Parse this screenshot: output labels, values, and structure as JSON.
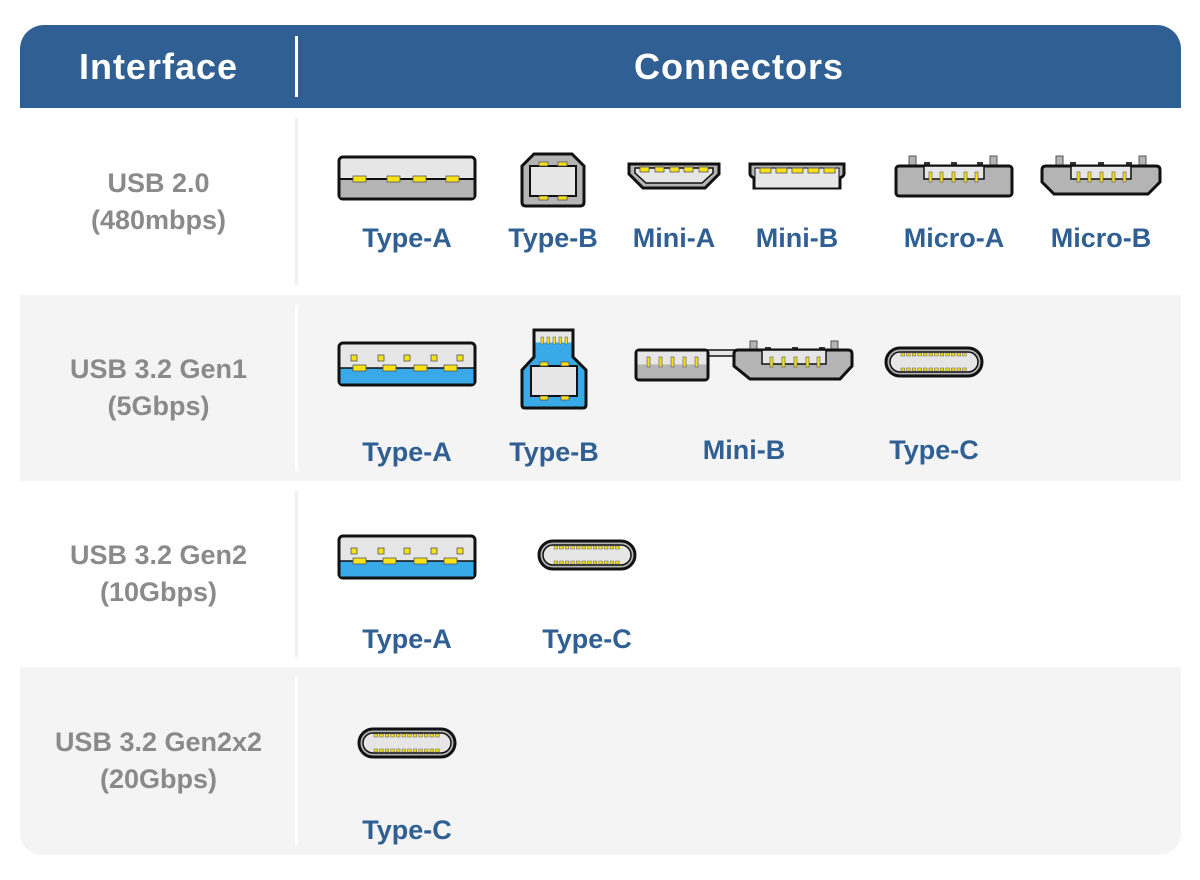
{
  "header": {
    "interface": "Interface",
    "connectors": "Connectors"
  },
  "colors": {
    "header_bg": "#2f5f93",
    "label_gray": "#8a8a8a",
    "connector_name_blue": "#2f5f93",
    "usb3_blue": "#39a9e8",
    "pin_yellow": "#f7e217",
    "shell_gray": "#b4b4b4",
    "inner_light": "#e6e6e6"
  },
  "rows": [
    {
      "interface": "USB 2.0",
      "speed": "(480mbps)",
      "connectors": [
        {
          "name": "Type-A",
          "icon": "usb2-type-a-icon"
        },
        {
          "name": "Type-B",
          "icon": "usb2-type-b-icon"
        },
        {
          "name": "Mini-A",
          "icon": "mini-a-icon"
        },
        {
          "name": "Mini-B",
          "icon": "mini-b-icon"
        },
        {
          "name": "Micro-A",
          "icon": "micro-a-icon"
        },
        {
          "name": "Micro-B",
          "icon": "micro-b-icon"
        }
      ]
    },
    {
      "interface": "USB 3.2 Gen1",
      "speed": "(5Gbps)",
      "connectors": [
        {
          "name": "Type-A",
          "icon": "usb3-type-a-icon"
        },
        {
          "name": "Type-B",
          "icon": "usb3-type-b-icon"
        },
        {
          "name": "Mini-B",
          "icon": "usb3-micro-b-icon"
        },
        {
          "name": "Type-C",
          "icon": "type-c-icon"
        }
      ]
    },
    {
      "interface": "USB 3.2 Gen2",
      "speed": "(10Gbps)",
      "connectors": [
        {
          "name": "Type-A",
          "icon": "usb3-type-a-icon"
        },
        {
          "name": "Type-C",
          "icon": "type-c-icon"
        }
      ]
    },
    {
      "interface": "USB 3.2 Gen2x2",
      "speed": "(20Gbps)",
      "connectors": [
        {
          "name": "Type-C",
          "icon": "type-c-icon"
        }
      ]
    }
  ]
}
